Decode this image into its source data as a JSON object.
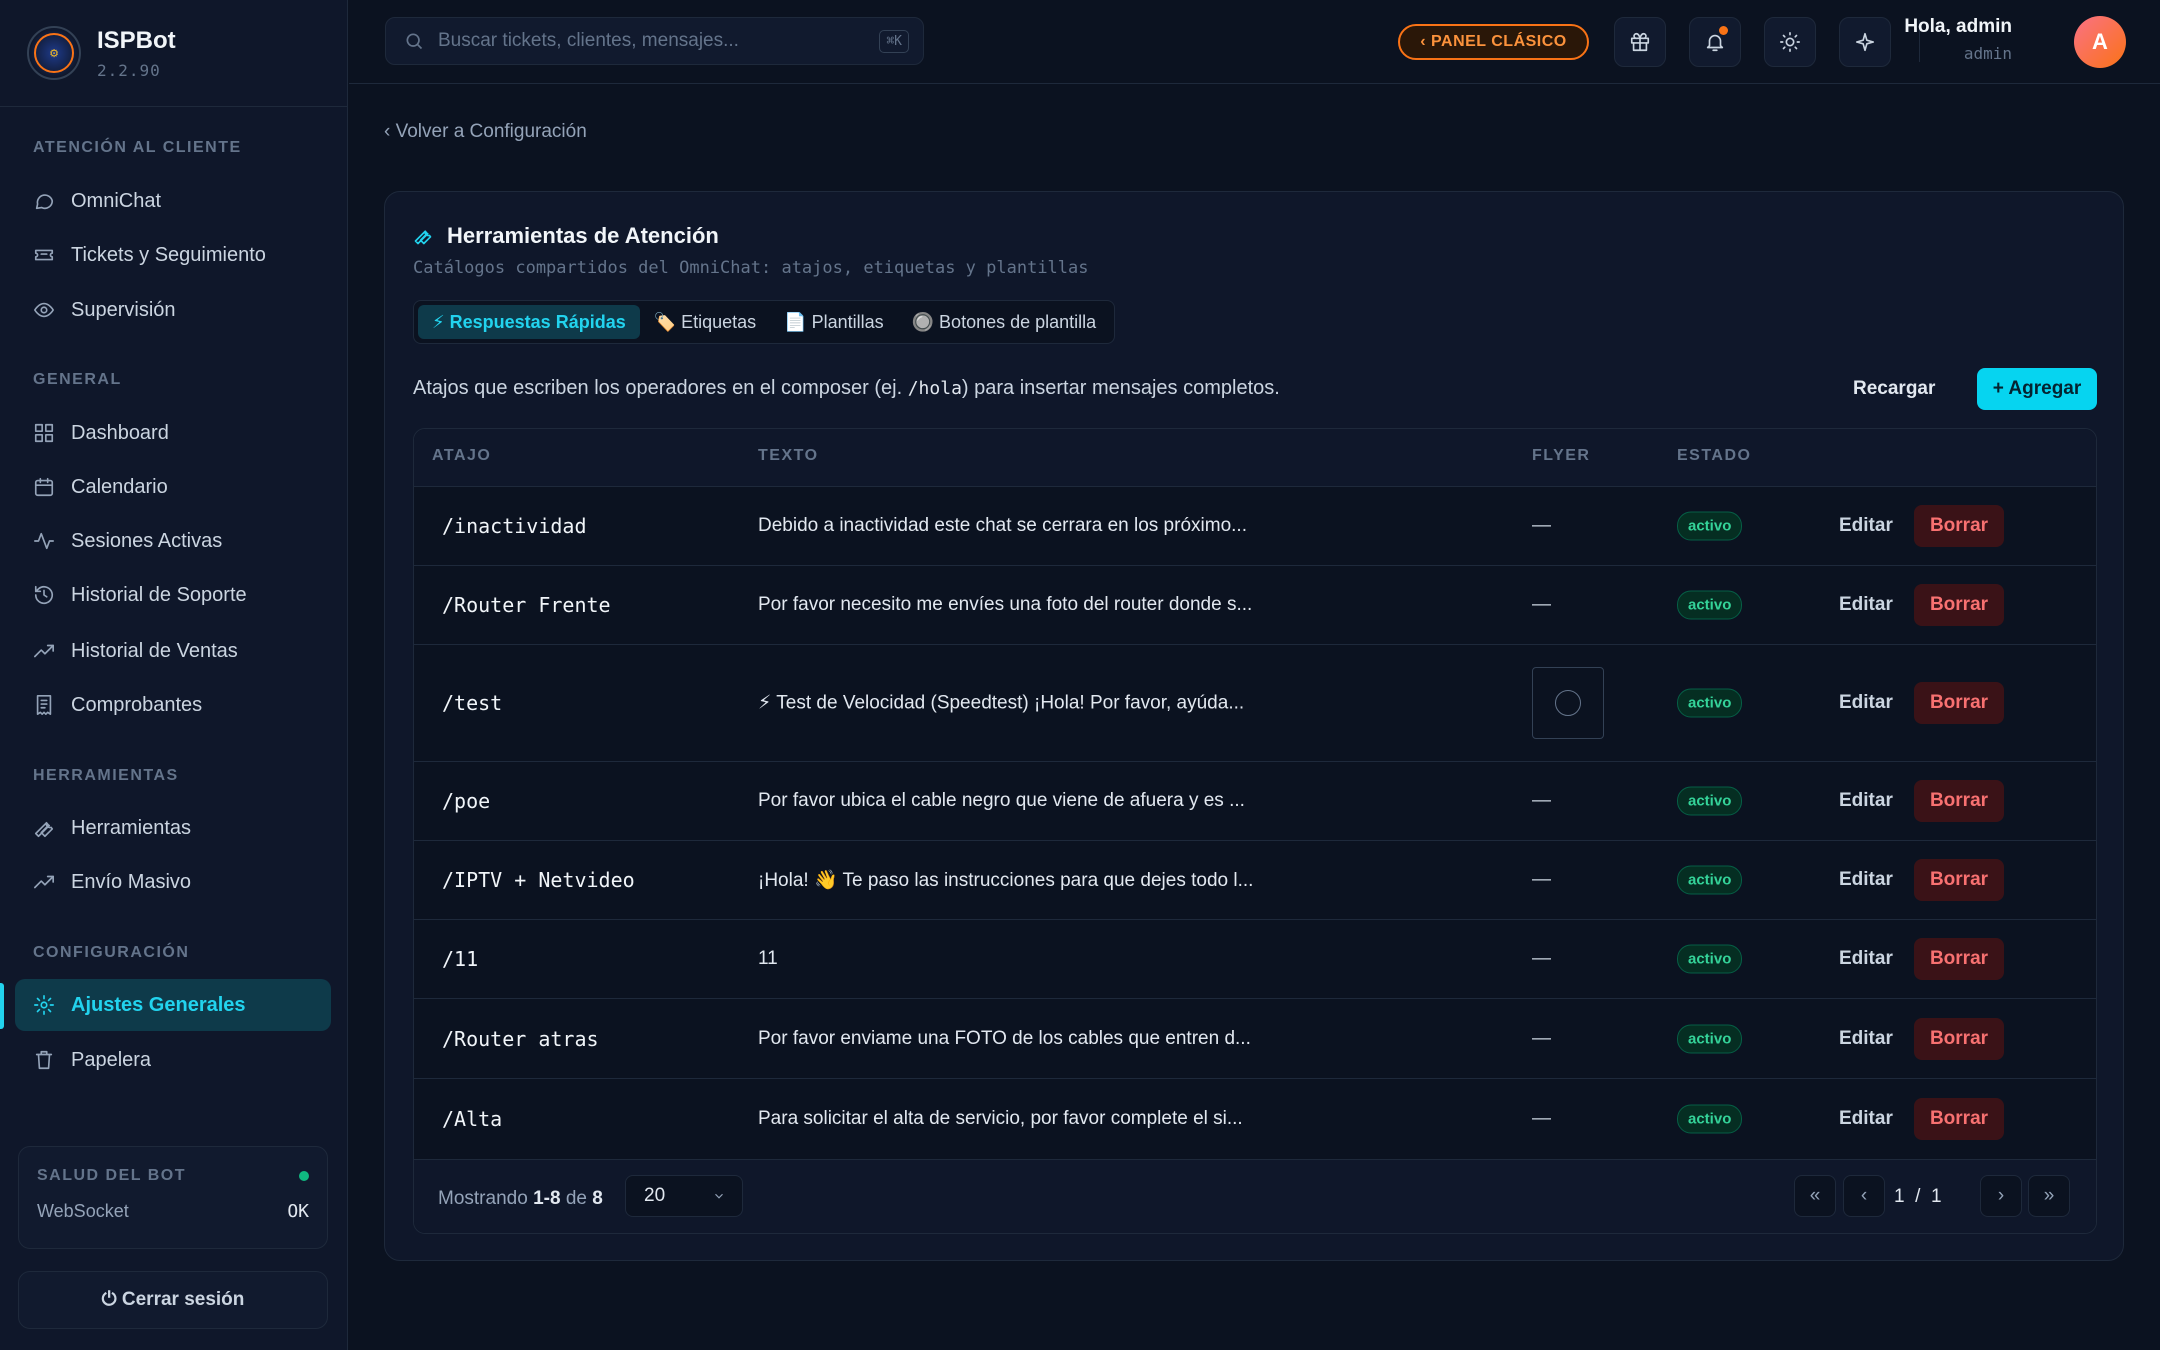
{
  "brand": {
    "name": "ISPBot",
    "version": "2.2.90"
  },
  "sidebar": {
    "sections": [
      {
        "title": "ATENCIÓN AL CLIENTE"
      },
      {
        "title": "GENERAL"
      },
      {
        "title": "HERRAMIENTAS"
      },
      {
        "title": "CONFIGURACIÓN"
      }
    ],
    "items": [
      {
        "label": "OmniChat",
        "icon": "chat-icon"
      },
      {
        "label": "Tickets y Seguimiento",
        "icon": "ticket-icon"
      },
      {
        "label": "Supervisión",
        "icon": "eye-icon"
      },
      {
        "label": "Dashboard",
        "icon": "grid-icon"
      },
      {
        "label": "Calendario",
        "icon": "calendar-icon"
      },
      {
        "label": "Sesiones Activas",
        "icon": "activity-icon"
      },
      {
        "label": "Historial de Soporte",
        "icon": "history-icon"
      },
      {
        "label": "Historial de Ventas",
        "icon": "trending-icon"
      },
      {
        "label": "Comprobantes",
        "icon": "receipt-icon"
      },
      {
        "label": "Herramientas",
        "icon": "wrench-icon"
      },
      {
        "label": "Envío Masivo",
        "icon": "trending-icon"
      },
      {
        "label": "Ajustes Generales",
        "icon": "gear-icon",
        "active": true
      },
      {
        "label": "Papelera",
        "icon": "trash-icon"
      }
    ],
    "health": {
      "title": "SALUD DEL BOT",
      "label": "WebSocket",
      "value": "OK"
    },
    "logout": "⏻ Cerrar sesión"
  },
  "topbar": {
    "search_placeholder": "Buscar tickets, clientes, mensajes...",
    "shortcut": "⌘K",
    "classic_panel": "‹ PANEL CLÁSICO",
    "user": {
      "greeting": "Hola, admin",
      "role": "admin",
      "initial": "A"
    }
  },
  "main": {
    "back": "‹ Volver a Configuración",
    "title": "Herramientas de Atención",
    "subtitle": "Catálogos compartidos del OmniChat: atajos, etiquetas y plantillas",
    "tabs": [
      {
        "label": "⚡ Respuestas Rápidas",
        "active": true
      },
      {
        "label": "🏷️ Etiquetas"
      },
      {
        "label": "📄 Plantillas"
      },
      {
        "label": "🔘 Botones de plantilla"
      }
    ],
    "description_pre": "Atajos que escriben los operadores en el composer (ej. ",
    "description_code": "/hola",
    "description_post": ") para insertar mensajes completos.",
    "reload": "Recargar",
    "add": "+ Agregar",
    "columns": [
      "ATAJO",
      "TEXTO",
      "FLYER",
      "ESTADO"
    ],
    "rows": [
      {
        "shortcut": "/inactividad",
        "text": "Debido a inactividad este chat se cerrara en los próximo...",
        "flyer": "—",
        "status": "activo",
        "edit": "Editar",
        "delete": "Borrar"
      },
      {
        "shortcut": "/Router Frente",
        "text": "Por favor necesito me envíes una foto del router donde s...",
        "flyer": "—",
        "status": "activo",
        "edit": "Editar",
        "delete": "Borrar"
      },
      {
        "shortcut": "/test",
        "text": "⚡ Test de Velocidad (Speedtest) ¡Hola! Por favor, ayúda...",
        "flyer": "",
        "status": "activo",
        "edit": "Editar",
        "delete": "Borrar",
        "has_thumb": true
      },
      {
        "shortcut": "/poe",
        "text": "Por favor ubica el cable negro que viene de afuera y es ...",
        "flyer": "—",
        "status": "activo",
        "edit": "Editar",
        "delete": "Borrar"
      },
      {
        "shortcut": "/IPTV + Netvideo",
        "text": "¡Hola! 👋 Te paso las instrucciones para que dejes todo l...",
        "flyer": "—",
        "status": "activo",
        "edit": "Editar",
        "delete": "Borrar"
      },
      {
        "shortcut": "/11",
        "text": "11",
        "flyer": "—",
        "status": "activo",
        "edit": "Editar",
        "delete": "Borrar"
      },
      {
        "shortcut": "/Router atras",
        "text": "Por favor enviame una FOTO de los cables que entren d...",
        "flyer": "—",
        "status": "activo",
        "edit": "Editar",
        "delete": "Borrar"
      },
      {
        "shortcut": "/Alta",
        "text": "Para solicitar el alta de servicio, por favor complete el si...",
        "flyer": "—",
        "status": "activo",
        "edit": "Editar",
        "delete": "Borrar"
      }
    ],
    "pagination": {
      "showing_label": "Mostrando",
      "range": "1-8",
      "of_label": "de",
      "total": "8",
      "page_size": "20",
      "page_display": "1  /  1",
      "first": "«",
      "prev": "‹",
      "next": "›",
      "last": "»"
    }
  },
  "colors": {
    "accent": "#22d3ee",
    "brand_orange": "#f97316",
    "success": "#10b981",
    "danger": "#f87171"
  }
}
